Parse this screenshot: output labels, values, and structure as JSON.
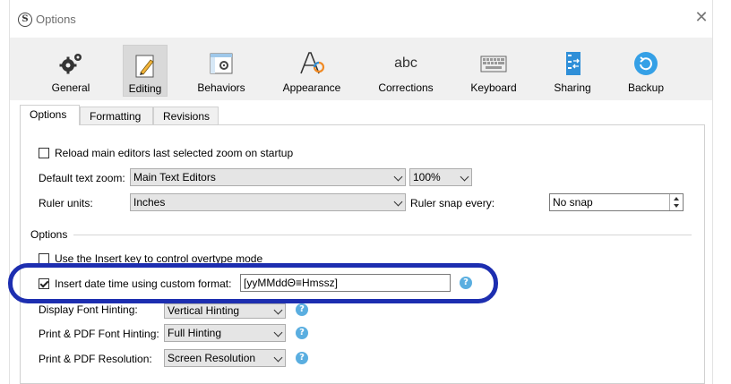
{
  "window": {
    "title": "Options",
    "logo_glyph": "S",
    "close_glyph": "✕"
  },
  "toolbar": {
    "items": [
      {
        "label": "General",
        "icon": "gears-icon"
      },
      {
        "label": "Editing",
        "icon": "pencil-icon",
        "selected": true
      },
      {
        "label": "Behaviors",
        "icon": "window-gear-icon"
      },
      {
        "label": "Appearance",
        "icon": "font-a-icon"
      },
      {
        "label": "Corrections",
        "icon": "abc-icon",
        "icon_text": "abc"
      },
      {
        "label": "Keyboard",
        "icon": "keyboard-icon"
      },
      {
        "label": "Sharing",
        "icon": "sync-doc-icon"
      },
      {
        "label": "Backup",
        "icon": "backup-icon"
      }
    ]
  },
  "tabs": [
    {
      "label": "Options",
      "active": true
    },
    {
      "label": "Formatting"
    },
    {
      "label": "Revisions"
    }
  ],
  "form": {
    "reload_zoom_label": "Reload main editors last selected zoom on startup",
    "default_zoom_label": "Default text zoom:",
    "default_zoom_value": "Main Text Editors",
    "zoom_percent_value": "100%",
    "ruler_units_label": "Ruler units:",
    "ruler_units_value": "Inches",
    "ruler_snap_label": "Ruler snap every:",
    "ruler_snap_value": "No snap",
    "options_group_label": "Options",
    "insert_key_label": "Use the Insert key to control overtype mode",
    "insert_date_label": "Insert date time using custom format:",
    "insert_date_value": "[yyMMddΘ≡Hmssz]",
    "font_hinting_label": "Display Font Hinting:",
    "font_hinting_value": "Vertical Hinting",
    "pdf_font_hinting_label": "Print & PDF Font Hinting:",
    "pdf_font_hinting_value": "Full Hinting",
    "pdf_resolution_label": "Print & PDF Resolution:",
    "pdf_resolution_value": "Screen Resolution",
    "help_glyph": "?"
  },
  "colors": {
    "highlight": "#1d2eb0",
    "help": "#5aaee0"
  }
}
